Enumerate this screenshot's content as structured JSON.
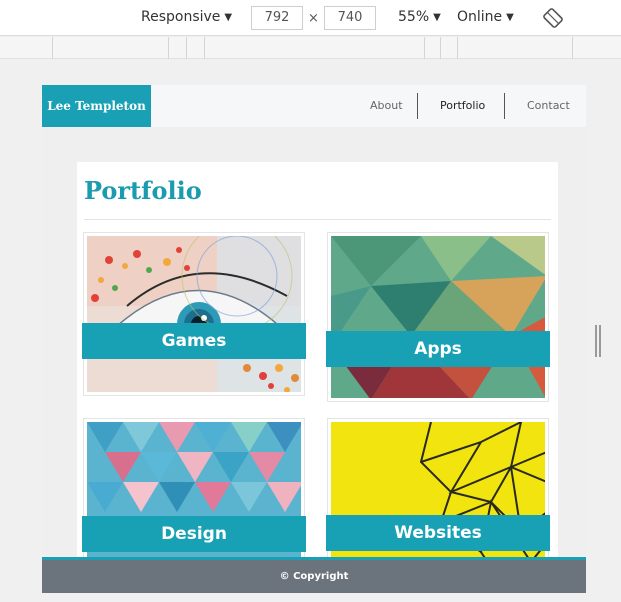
{
  "toolbar": {
    "device": "Responsive",
    "width": "792",
    "height": "740",
    "times": "×",
    "zoom": "55%",
    "throttle": "Online",
    "arrow": "▼",
    "rotate_icon": "rotate-icon"
  },
  "site": {
    "brand": "Lee Templeton",
    "nav": [
      "About",
      "Portfolio",
      "Contact"
    ],
    "page_title": "Portfolio",
    "tiles": [
      "Games",
      "Apps",
      "Design",
      "Websites"
    ],
    "footer": "© Copyright"
  },
  "colors": {
    "accent": "#1aa0b4",
    "footer_bg": "#6b737c"
  }
}
